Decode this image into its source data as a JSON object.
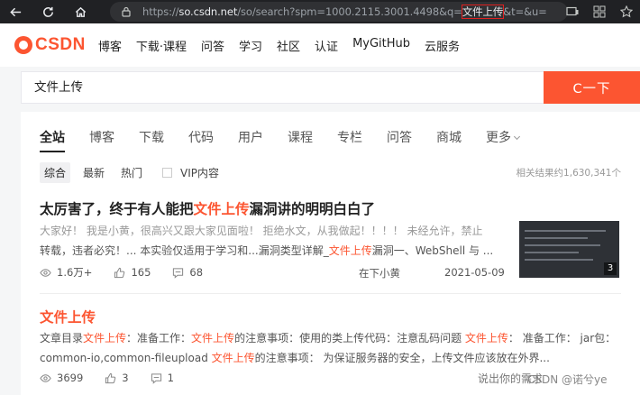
{
  "browser": {
    "url_prefix": "https://",
    "url_host": "so.csdn.net",
    "url_path": "/so/search?spm=1000.2115.3001.4498&q=",
    "url_query": "文件上传",
    "url_suffix": "&t=&u="
  },
  "header": {
    "logo_text": "CSDN",
    "nav": [
      "博客",
      "下载·课程",
      "问答",
      "学习",
      "社区",
      "认证",
      "MyGitHub",
      "云服务"
    ]
  },
  "search": {
    "value": "文件上传",
    "button_label": "C一下"
  },
  "tabs": [
    "全站",
    "博客",
    "下载",
    "代码",
    "用户",
    "课程",
    "专栏",
    "问答",
    "商城",
    "更多"
  ],
  "filters": {
    "chips": [
      "综合",
      "最新",
      "热门"
    ],
    "vip_label": "VIP内容",
    "result_count": "相关结果约1,630,341个"
  },
  "results": [
    {
      "title_pre": "太厉害了，终于有人能把",
      "title_hl": "文件上传",
      "title_post": "漏洞讲的明明白白了",
      "snippet_line1": "大家好！ 我是小黄，很高兴又跟大家见面啦！ 拒绝水文，从我做起！！！！ 未经允许，禁止",
      "snippet_line2_a": "转载，违者必究！... 本实验仅适用于学习和...漏洞类型详解_",
      "snippet_line2_hl": "文件上传",
      "snippet_line2_b": "漏洞一、WebShell 与 ...",
      "views": "1.6万+",
      "likes": "165",
      "comments": "68",
      "author": "在下小黄",
      "date": "2021-05-09",
      "thumb_badge": "3"
    },
    {
      "title_hl": "文件上传",
      "line1_a": "文章目录",
      "line1_hl1": "文件上传",
      "line1_b": "：准备工作：",
      "line1_hl2": "文件上传",
      "line1_c": "的注意事项：使用的类上传代码：注意乱码问题 ",
      "line1_hl3": "文件上传",
      "line1_d": "： 准备工作：  jar包：",
      "line2_a": "common-io,common-fileupload ",
      "line2_hl": "文件上传",
      "line2_b": "的注意事项： 为保证服务器的安全，上传文件应该放在外界...",
      "views": "3699",
      "likes": "3",
      "comments": "1",
      "suggestion": "说出你的需求",
      "watermark": "CSDN @诺兮ye"
    }
  ]
}
